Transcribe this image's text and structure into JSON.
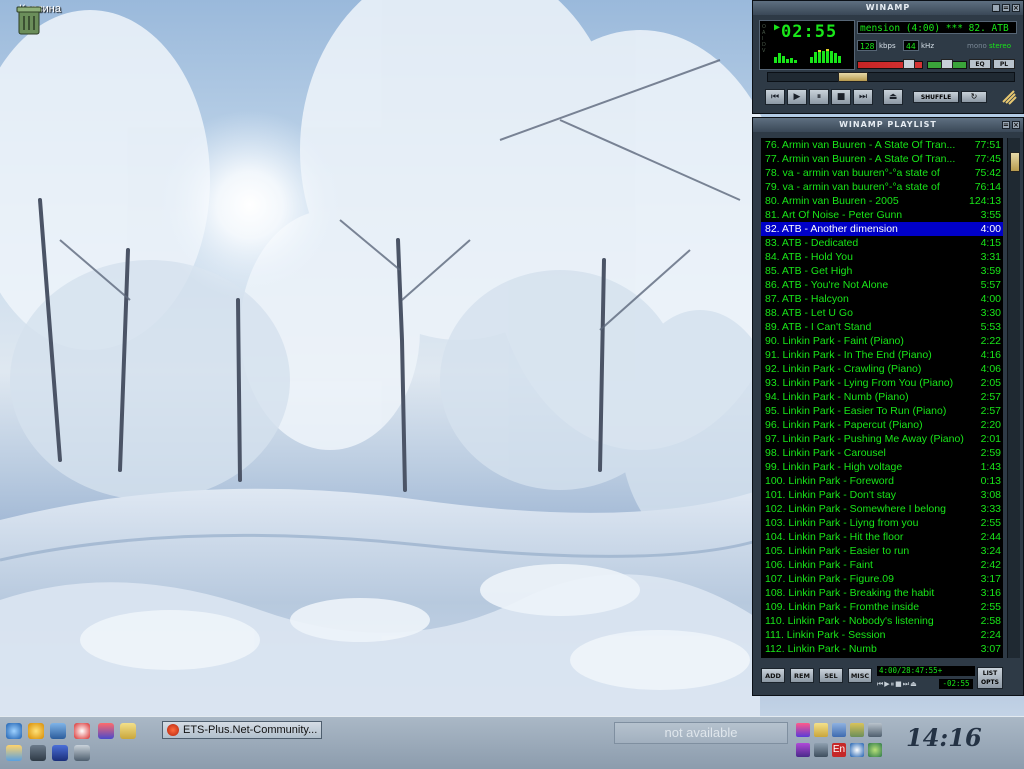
{
  "desktop": {
    "icons": [
      {
        "label": "Корзина",
        "icon": "recycle-bin-icon"
      }
    ]
  },
  "winamp": {
    "title": "WINAMP",
    "time": "02:55",
    "ticker": "mension (4:00) *** 82. ATB - An",
    "kbps": "128",
    "kbps_unit": "kbps",
    "khz": "44",
    "khz_unit": "kHz",
    "mono": "mono",
    "stereo": "stereo",
    "eq_label": "EQ",
    "pl_label": "PL",
    "shuffle_label": "SHUFFLE",
    "seek_position": 0.32,
    "volume_level": 0.86,
    "colors": {
      "display": "#19e619",
      "volume": "#c72424",
      "selection": "#0000c8"
    }
  },
  "playlist": {
    "title": "WINAMP PLAYLIST",
    "items": [
      {
        "title": "76. Armin van Buuren - A State Of Tran...",
        "duration": "77:51"
      },
      {
        "title": "77. Armin van Buuren - A State Of Tran...",
        "duration": "77:45"
      },
      {
        "title": "78. va - armin van buuren°-°a state of",
        "duration": "75:42"
      },
      {
        "title": "79. va - armin van buuren°-°a state of",
        "duration": "76:14"
      },
      {
        "title": "80. Armin van Buuren  - 2005",
        "duration": "124:13"
      },
      {
        "title": "81. Art Of Noise - Peter Gunn",
        "duration": "3:55"
      },
      {
        "title": "82. ATB - Another dimension",
        "duration": "4:00",
        "selected": true
      },
      {
        "title": "83. ATB - Dedicated",
        "duration": "4:15"
      },
      {
        "title": "84. ATB - Hold You",
        "duration": "3:31"
      },
      {
        "title": "85. ATB - Get High",
        "duration": "3:59"
      },
      {
        "title": "86. ATB - You're Not Alone",
        "duration": "5:57"
      },
      {
        "title": "87. ATB - Halcyon",
        "duration": "4:00"
      },
      {
        "title": "88. ATB - Let U Go",
        "duration": "3:30"
      },
      {
        "title": "89. ATB - I Can't Stand",
        "duration": "5:53"
      },
      {
        "title": "90. Linkin Park - Faint (Piano)",
        "duration": "2:22"
      },
      {
        "title": "91. Linkin Park - In The End (Piano)",
        "duration": "4:16"
      },
      {
        "title": "92. Linkin Park - Crawling (Piano)",
        "duration": "4:06"
      },
      {
        "title": "93. Linkin Park - Lying From You (Piano)",
        "duration": "2:05"
      },
      {
        "title": "94. Linkin Park - Numb (Piano)",
        "duration": "2:57"
      },
      {
        "title": "95. Linkin Park - Easier To Run (Piano)",
        "duration": "2:57"
      },
      {
        "title": "96. Linkin Park - Papercut (Piano)",
        "duration": "2:20"
      },
      {
        "title": "97. Linkin Park - Pushing Me Away (Piano)",
        "duration": "2:01"
      },
      {
        "title": "98. Linkin Park - Carousel",
        "duration": "2:59"
      },
      {
        "title": "99. Linkin Park - High voltage",
        "duration": "1:43"
      },
      {
        "title": "100. Linkin Park - Foreword",
        "duration": "0:13"
      },
      {
        "title": "101. Linkin Park - Don't stay",
        "duration": "3:08"
      },
      {
        "title": "102. Linkin Park - Somewhere I belong",
        "duration": "3:33"
      },
      {
        "title": "103. Linkin Park - Liyng from you",
        "duration": "2:55"
      },
      {
        "title": "104. Linkin Park - Hit the floor",
        "duration": "2:44"
      },
      {
        "title": "105. Linkin Park - Easier to run",
        "duration": "3:24"
      },
      {
        "title": "106. Linkin Park - Faint",
        "duration": "2:42"
      },
      {
        "title": "107. Linkin Park - Figure.09",
        "duration": "3:17"
      },
      {
        "title": "108. Linkin Park - Breaking the habit",
        "duration": "3:16"
      },
      {
        "title": "109. Linkin Park - Fromthe inside",
        "duration": "2:55"
      },
      {
        "title": "110. Linkin Park - Nobody's listening",
        "duration": "2:58"
      },
      {
        "title": "111. Linkin Park - Session",
        "duration": "2:24"
      },
      {
        "title": "112. Linkin Park - Numb",
        "duration": "3:07"
      }
    ],
    "buttons": {
      "add": "ADD",
      "rem": "REM",
      "sel": "SEL",
      "misc": "MISC",
      "list_opts_1": "LIST",
      "list_opts_2": "OPTS"
    },
    "info": "4:00/28:47:55+",
    "mini_time": "-02:55"
  },
  "taskbar": {
    "task_label": "ETS-Plus.Net-Community...",
    "status_text": "not available",
    "clock": "14:16",
    "lang_indicator": "En"
  }
}
